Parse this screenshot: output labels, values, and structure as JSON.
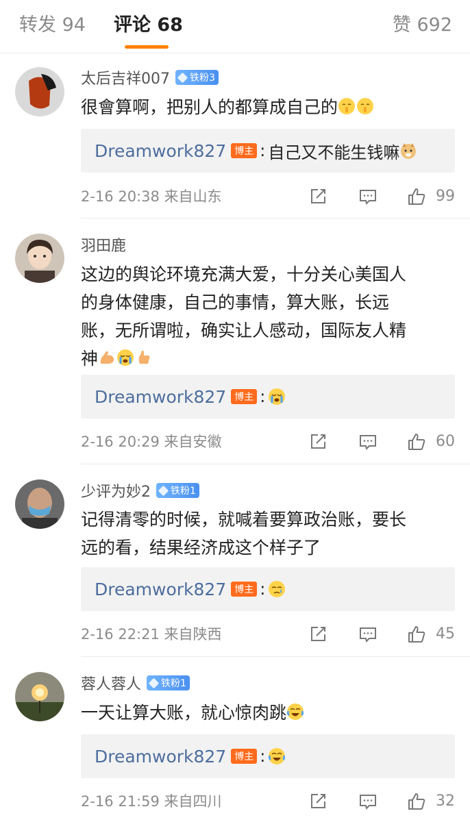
{
  "tabs": {
    "repost": "转发 94",
    "comment": "评论 68",
    "like": "赞 692"
  },
  "comments": [
    {
      "username": "太后吉祥007",
      "fan_badge": "铁粉3",
      "text": "很會算啊，把别人的都算成自己的",
      "text_emojis": [
        "shush-emoji",
        "shush-emoji"
      ],
      "reply": {
        "name": "Dreamwork827",
        "badge": "博主",
        "text": "自己又不能生钱嘛",
        "emoji": "doge-emoji"
      },
      "time": "2-16 20:38",
      "source": "来自山东",
      "likes": "99"
    },
    {
      "username": "羽田鹿",
      "fan_badge": "",
      "text_lines": [
        "这边的舆论环境充满大爱，十分关心美国人",
        "的身体健康，自己的事情，算大账，长远",
        "账，无所谓啦，确实让人感动，国际友人精",
        "神"
      ],
      "text_emojis": [
        "muscle-emoji",
        "crying-emoji",
        "thumbs-up-emoji"
      ],
      "reply": {
        "name": "Dreamwork827",
        "badge": "博主",
        "text": "",
        "emoji": "crying-emoji"
      },
      "time": "2-16 20:29",
      "source": "来自安徽",
      "likes": "60"
    },
    {
      "username": "少评为妙2",
      "fan_badge": "铁粉1",
      "text_lines": [
        "记得清零的时候，就喊着要算政治账，要长",
        "远的看，结果经济成这个样子了"
      ],
      "reply": {
        "name": "Dreamwork827",
        "badge": "博主",
        "text": "",
        "emoji": "sad-emoji"
      },
      "time": "2-16 22:21",
      "source": "来自陕西",
      "likes": "45"
    },
    {
      "username": "蓉人蓉人",
      "fan_badge": "铁粉1",
      "text": "一天让算大账，就心惊肉跳",
      "text_emojis": [
        "laugh-cry-emoji"
      ],
      "reply": {
        "name": "Dreamwork827",
        "badge": "博主",
        "text": "",
        "emoji": "laugh-cry-emoji"
      },
      "time": "2-16 21:59",
      "source": "来自四川",
      "likes": "32"
    }
  ],
  "colors": {
    "accent": "#ff8200",
    "reply_name": "#4d6e9e",
    "host_badge": "#ff6b1c",
    "fan_badge": "#4a90f0"
  }
}
